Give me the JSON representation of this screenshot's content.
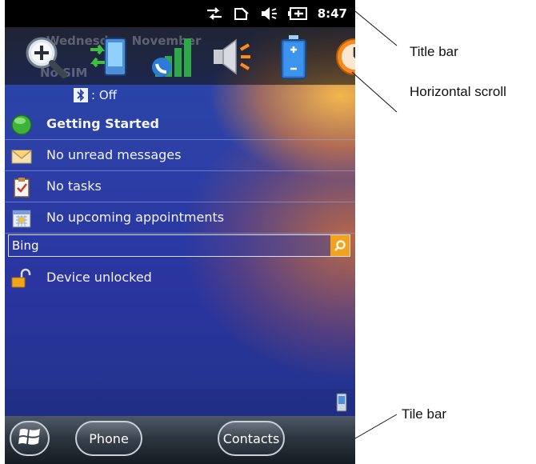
{
  "status_bar": {
    "time": "8:47",
    "icons": [
      "sync-arrows-icon",
      "no-signal-icon",
      "speaker-icon",
      "battery-charging-icon"
    ]
  },
  "today": {
    "header_partial": "Wednesday, November",
    "sim_partial": "No SIM",
    "bluetooth_status": ": Off",
    "items": [
      {
        "label": "Getting Started",
        "icon": "getting-started-icon"
      },
      {
        "label": "No unread messages",
        "icon": "envelope-icon"
      },
      {
        "label": "No tasks",
        "icon": "clipboard-icon"
      },
      {
        "label": "No upcoming appointments",
        "icon": "calendar-icon"
      }
    ],
    "search": {
      "value": "Bing"
    },
    "lock_status": "Device unlocked"
  },
  "horizontal_scroll_icons": [
    "zoom-icon",
    "connection-icon",
    "signal-icon",
    "volume-icon",
    "battery-icon",
    "clock-icon"
  ],
  "tile_bar": {
    "start_icon": "windows-start-icon",
    "left_softkey": "Phone",
    "right_softkey": "Contacts"
  },
  "callouts": {
    "title_bar": "Title bar",
    "horizontal_scroll": "Horizontal scroll",
    "tile_bar": "Tile bar"
  }
}
